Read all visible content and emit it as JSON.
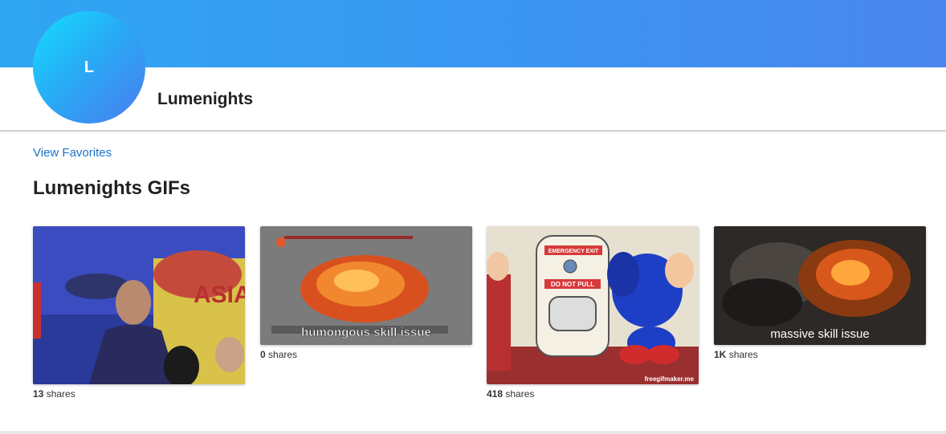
{
  "profile": {
    "avatar_initial": "L",
    "username": "Lumenights",
    "banner_color_start": "#2fa6f2",
    "banner_color_end": "#4a86ee"
  },
  "nav": {
    "view_favorites": "View Favorites"
  },
  "section": {
    "title": "Lumenights GIFs"
  },
  "gifs": [
    {
      "caption": "",
      "share_count": "13",
      "shares_label": "shares"
    },
    {
      "caption": "humongous skill issue",
      "share_count": "0",
      "shares_label": "shares"
    },
    {
      "caption": "",
      "share_count": "418",
      "shares_label": "shares",
      "sign_1": "EMERGENCY EXIT",
      "sign_2": "DO NOT PULL",
      "sign_3": "ASIA",
      "watermark": "freegifmaker.me"
    },
    {
      "caption": "massive skill issue",
      "share_count": "1K",
      "shares_label": "shares"
    }
  ],
  "gif1_sign": "ASIA",
  "gif3_text": {
    "sign_1": "EMERGENCY EXIT",
    "sign_2": "DO NOT PULL",
    "watermark": "freegifmaker.me"
  }
}
